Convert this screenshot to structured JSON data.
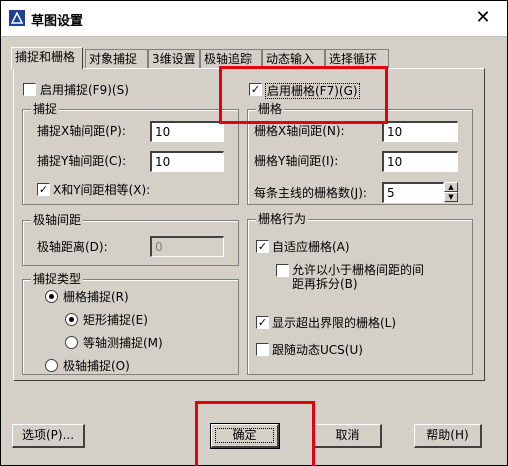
{
  "window": {
    "title": "草图设置",
    "close_label": "✕",
    "title_icon": "cad-app-icon"
  },
  "tabs": [
    "捕捉和栅格",
    "对象捕捉",
    "3维设置",
    "极轴追踪",
    "动态输入",
    "选择循环"
  ],
  "snap": {
    "enable_label": "启用捕捉(F9)(S)",
    "group_title": "捕捉",
    "x_label": "捕捉X轴间距(P):",
    "x_value": "10",
    "y_label": "捕捉Y轴间距(C):",
    "y_value": "10",
    "equal_label": "X和Y间距相等(X):"
  },
  "polar": {
    "group_title": "极轴间距",
    "distance_label": "极轴距离(D):",
    "distance_value": "0"
  },
  "snap_type": {
    "group_title": "捕捉类型",
    "grid_snap": "栅格捕捉(R)",
    "rect_snap": "矩形捕捉(E)",
    "iso_snap": "等轴测捕捉(M)",
    "polar_snap": "极轴捕捉(O)"
  },
  "grid": {
    "enable_label": "启用栅格(F7)(G)",
    "group_title": "栅格",
    "x_label": "栅格X轴间距(N):",
    "x_value": "10",
    "y_label": "栅格Y轴间距(I):",
    "y_value": "10",
    "major_label": "每条主线的栅格数(J):",
    "major_value": "5"
  },
  "grid_behavior": {
    "group_title": "栅格行为",
    "adaptive": "自适应栅格(A)",
    "subdivide_line1": "允许以小于栅格间距的间",
    "subdivide_line2": "距再拆分(B)",
    "beyond_limits": "显示超出界限的栅格(L)",
    "follow_ucs": "跟随动态UCS(U)"
  },
  "buttons": {
    "options": "选项(P)...",
    "ok": "确定",
    "cancel": "取消",
    "help": "帮助(H)"
  },
  "colors": {
    "highlight": "#e3000f",
    "dialog_bg": "#d4d0c8"
  }
}
